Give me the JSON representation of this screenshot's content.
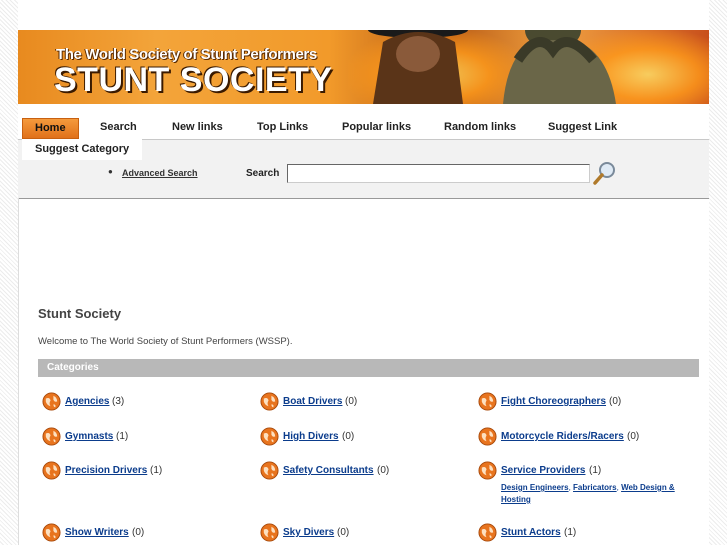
{
  "banner": {
    "tagline": "The World Society of Stunt Performers",
    "brand": "STUNT SOCIETY"
  },
  "nav": {
    "items": [
      "Home",
      "Search",
      "New links",
      "Top Links",
      "Popular links",
      "Random links",
      "Suggest Link"
    ],
    "row2": "Suggest Category",
    "active": "Home",
    "accent": "#e98526"
  },
  "search": {
    "advanced_label": "Advanced Search",
    "label": "Search",
    "value": "",
    "button_icon": "magnifier-icon"
  },
  "main": {
    "title": "Stunt Society",
    "welcome": "Welcome to The World Society of Stunt Performers (WSSP).",
    "categories_header": "Categories",
    "categories": [
      {
        "name": "Agencies",
        "count": "(3)"
      },
      {
        "name": "Boat Drivers",
        "count": "(0)"
      },
      {
        "name": "Fight Choreographers",
        "count": "(0)"
      },
      {
        "name": "Gymnasts",
        "count": "(1)"
      },
      {
        "name": "High Divers",
        "count": "(0)"
      },
      {
        "name": "Motorcycle Riders/Racers",
        "count": "(0)"
      },
      {
        "name": "Precision Drivers",
        "count": "(1)"
      },
      {
        "name": "Safety Consultants",
        "count": "(0)"
      },
      {
        "name": "Service Providers",
        "count": "(1)"
      },
      {
        "name": "Show Writers",
        "count": "(0)"
      },
      {
        "name": "Sky Divers",
        "count": "(0)"
      },
      {
        "name": "Stunt Actors",
        "count": "(1)"
      }
    ],
    "subcategories": {
      "service_providers": [
        "Design Engineers",
        "Fabricators",
        "Web Design & Hosting"
      ]
    },
    "link_color": "#0b3c8c",
    "icon": "globe-icon"
  }
}
